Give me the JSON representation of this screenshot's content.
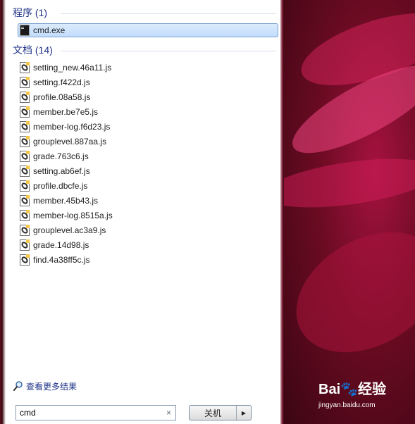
{
  "programs_header": "程序 (1)",
  "programs": [
    {
      "label": "cmd.exe",
      "icon": "cmd-icon"
    }
  ],
  "documents_header": "文档 (14)",
  "documents": [
    {
      "label": "setting_new.46a11.js",
      "icon": "js-file-icon"
    },
    {
      "label": "setting.f422d.js",
      "icon": "js-file-icon"
    },
    {
      "label": "profile.08a58.js",
      "icon": "js-file-icon"
    },
    {
      "label": "member.be7e5.js",
      "icon": "js-file-icon"
    },
    {
      "label": "member-log.f6d23.js",
      "icon": "js-file-icon"
    },
    {
      "label": "grouplevel.887aa.js",
      "icon": "js-file-icon"
    },
    {
      "label": "grade.763c6.js",
      "icon": "js-file-icon"
    },
    {
      "label": "setting.ab6ef.js",
      "icon": "js-file-icon"
    },
    {
      "label": "profile.dbcfe.js",
      "icon": "js-file-icon"
    },
    {
      "label": "member.45b43.js",
      "icon": "js-file-icon"
    },
    {
      "label": "member-log.8515a.js",
      "icon": "js-file-icon"
    },
    {
      "label": "grouplevel.ac3a9.js",
      "icon": "js-file-icon"
    },
    {
      "label": "grade.14d98.js",
      "icon": "js-file-icon"
    },
    {
      "label": "find.4a38ff5c.js",
      "icon": "js-file-icon"
    }
  ],
  "see_more": "查看更多结果",
  "search": {
    "value": "cmd",
    "clear": "×"
  },
  "shutdown": {
    "label": "关机",
    "arrow": "▶"
  },
  "watermark": {
    "logo": "Bai🐾经验",
    "url": "jingyan.baidu.com"
  },
  "colors": {
    "header": "#1e3287",
    "selection": "#c1dcfc",
    "wallpaper": "#a51240"
  }
}
